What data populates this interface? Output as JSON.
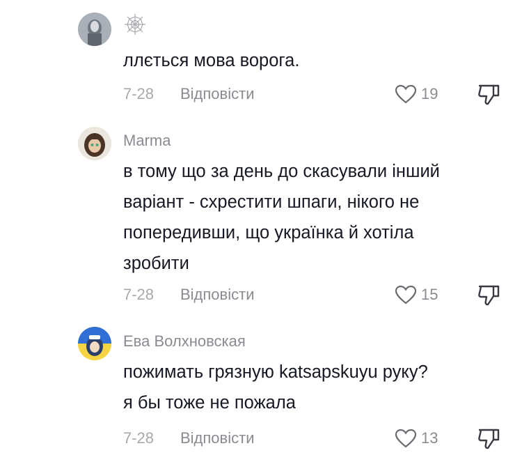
{
  "comments": [
    {
      "username": "",
      "text_lines": [
        "ллється мова ворога."
      ],
      "date": "7-28",
      "reply_label": "Відповісти",
      "likes": "19"
    },
    {
      "username": "Marma",
      "text_lines": [
        "в тому що за день до скасували інший",
        "варіант - схрестити шпаги, нікого не",
        "попередивши, що українка й хотіла",
        "зробити"
      ],
      "date": "7-28",
      "reply_label": "Відповісти",
      "likes": "15"
    },
    {
      "username": "Ева Волхновская",
      "text_lines": [
        "пожимать грязную katsapskuyu руку?",
        "я бы тоже не пожала"
      ],
      "date": "7-28",
      "reply_label": "Відповісти",
      "likes": "13"
    }
  ],
  "icons": {
    "like": "heart-outline-icon",
    "dislike": "thumbs-down-outline-icon",
    "badge": "spider-web-icon"
  },
  "colors": {
    "text": "#161823",
    "secondary": "#8a8b91",
    "date": "#a8a9ae"
  }
}
